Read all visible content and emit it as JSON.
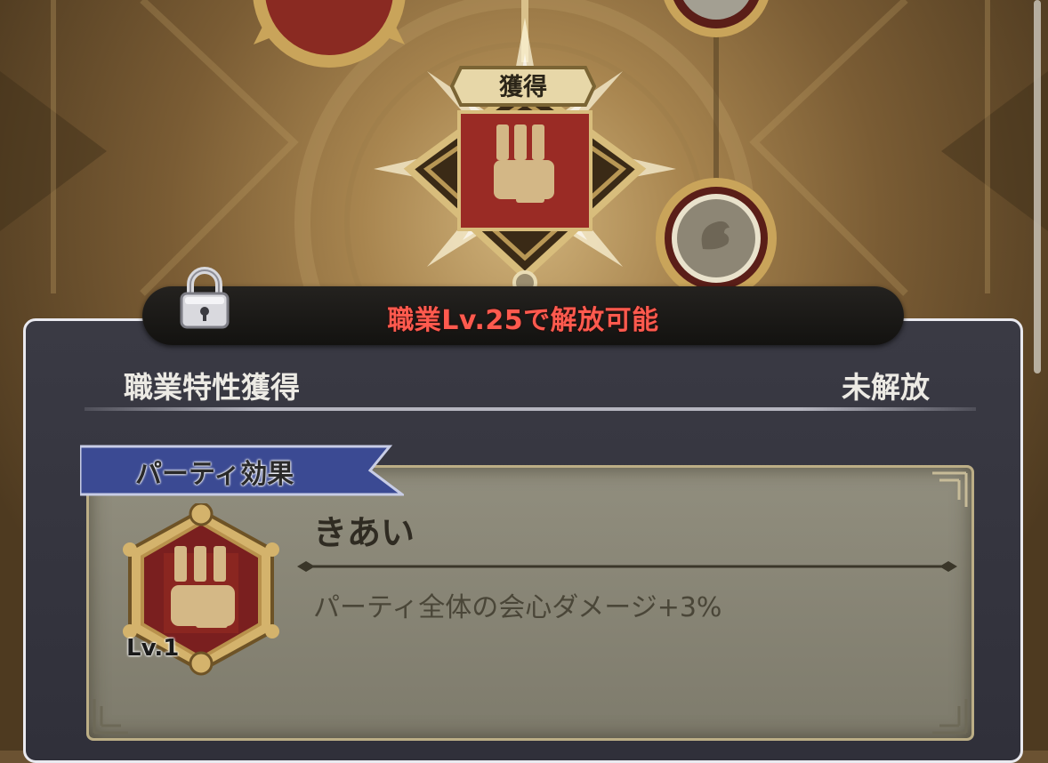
{
  "tree": {
    "obtained_tag": "獲得",
    "center_node_icon": "fist-icon",
    "side_node_icon": "beast-icon"
  },
  "unlock_banner": {
    "text": "職業Lv.25で解放可能",
    "lock_icon": "padlock-icon",
    "text_color": "#ff5a4e"
  },
  "panel": {
    "title": "職業特性獲得",
    "status": "未解放",
    "effect": {
      "category": "パーティ効果",
      "name": "きあい",
      "description": "パーティ全体の会心ダメージ+3%",
      "level": "Lv.1",
      "icon": "fist-medal-icon"
    }
  },
  "colors": {
    "panel_bg": "#34343e",
    "card_bg": "#8a8777",
    "ribbon": "#3c4a8e",
    "gold": "#c9a45a",
    "medal_red": "#7a1f1f"
  }
}
